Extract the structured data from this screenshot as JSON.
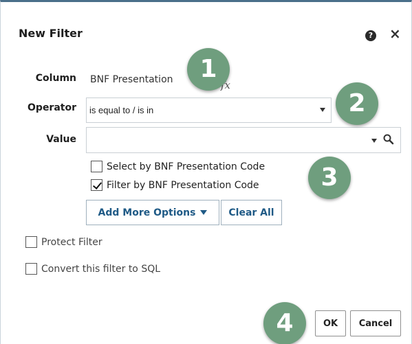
{
  "dialog": {
    "title": "New Filter",
    "help_icon": "question-icon",
    "close_icon": "close-icon",
    "help_glyph": "?",
    "close_glyph": "×"
  },
  "column": {
    "label": "Column",
    "value": "BNF Presentation",
    "fx": "fx"
  },
  "operator": {
    "label": "Operator",
    "selected": "is equal to / is in"
  },
  "value": {
    "label": "Value",
    "current": "",
    "placeholder": ""
  },
  "options": {
    "select_by_code": {
      "label": "Select by BNF Presentation Code",
      "checked": false
    },
    "filter_by_code": {
      "label": "Filter by BNF Presentation Code",
      "checked": true
    }
  },
  "buttons": {
    "add_more": "Add More Options",
    "clear_all": "Clear All",
    "ok": "OK",
    "cancel": "Cancel"
  },
  "protect_filter": {
    "label": "Protect Filter",
    "checked": false
  },
  "convert_sql": {
    "label": "Convert this filter to SQL",
    "checked": false
  },
  "callouts": [
    "1",
    "2",
    "3",
    "4"
  ],
  "colors": {
    "callout": "#6f9e7e",
    "button_text": "#1f5a86",
    "border_top": "#4a6f8a"
  }
}
